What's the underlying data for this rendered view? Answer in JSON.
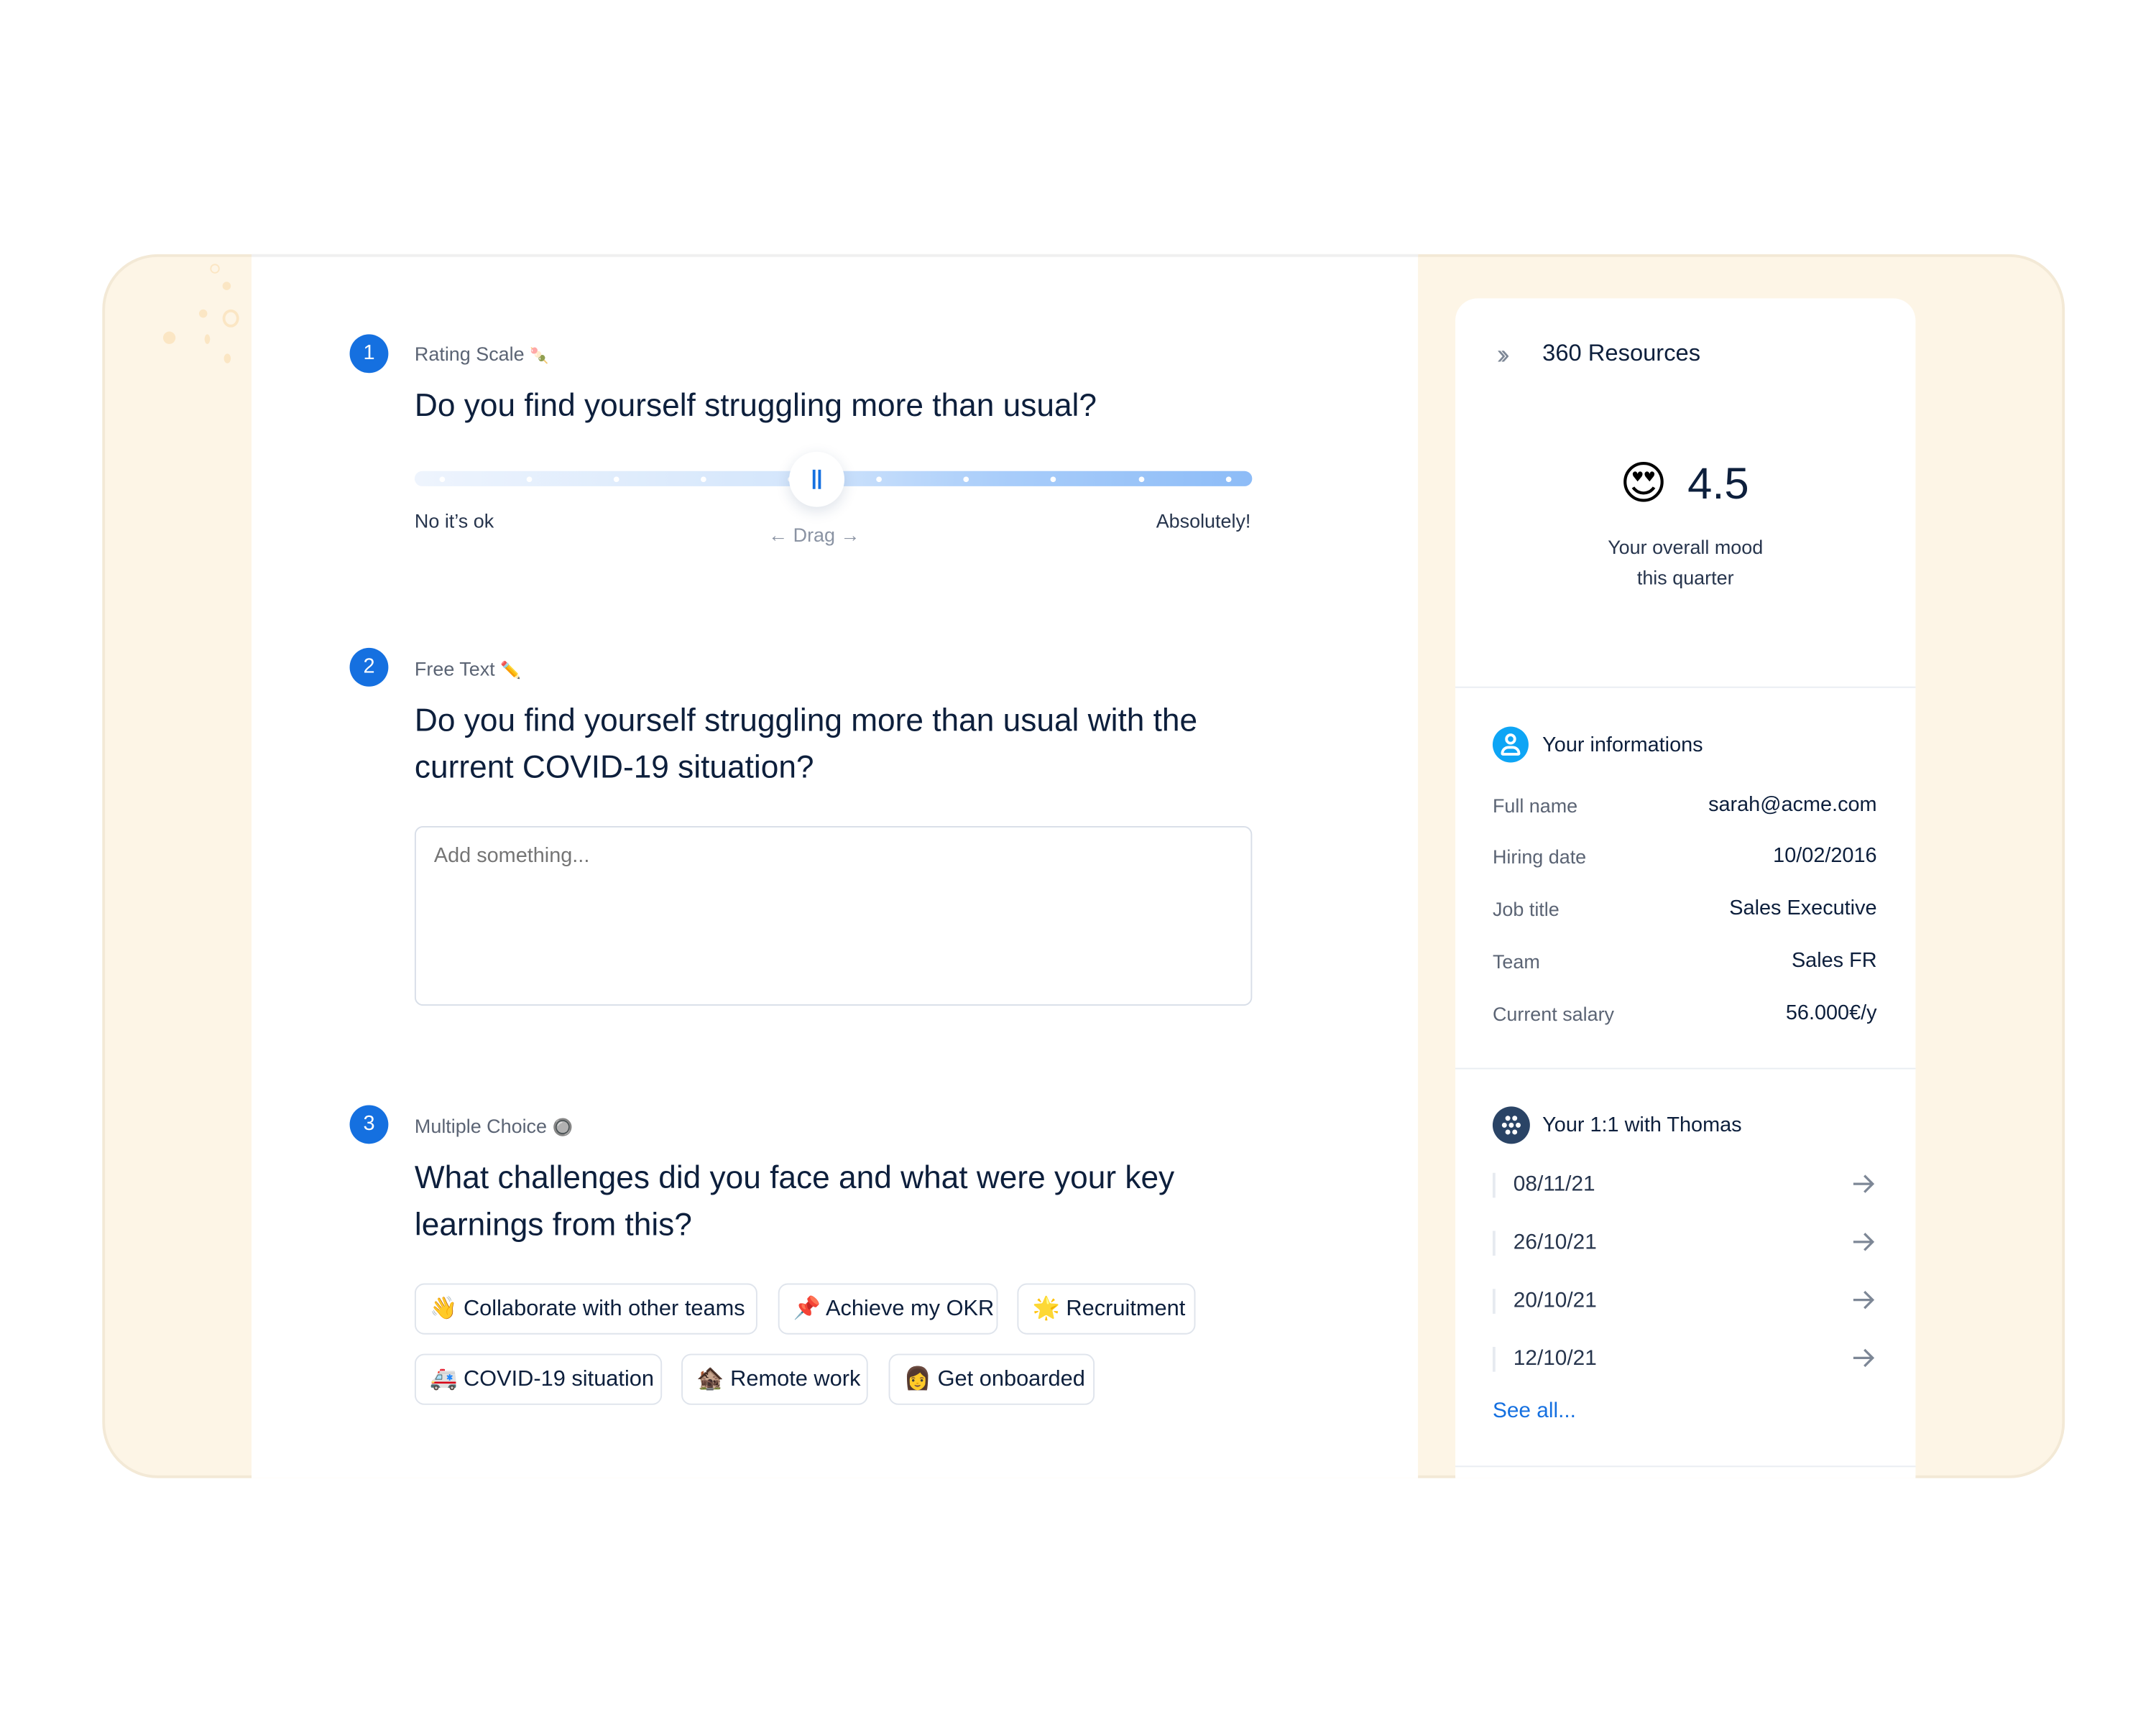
{
  "colors": {
    "accent": "#1570e0",
    "navy": "#0d1f3c",
    "frame_bg": "#fdf5e6"
  },
  "questions": [
    {
      "number": "1",
      "type_label": "Rating Scale",
      "type_emoji": "🍡",
      "title": "Do you find yourself struggling more than usual?",
      "slider": {
        "min_label": "No it’s ok",
        "max_label": "Absolutely!",
        "drag_label": "Drag",
        "value_fraction": 0.48
      }
    },
    {
      "number": "2",
      "type_label": "Free Text",
      "type_emoji": "✏️",
      "title": "Do you find yourself struggling more than usual with the current COVID-19 situation?",
      "placeholder": "Add something..."
    },
    {
      "number": "3",
      "type_label": "Multiple Choice",
      "type_emoji": "🔘",
      "title": "What challenges did you face and what were your key learnings from this?",
      "choices": [
        {
          "emoji": "👋",
          "label": "Collaborate with other teams"
        },
        {
          "emoji": "📌",
          "label": "Achieve my OKR"
        },
        {
          "emoji": "🌟",
          "label": "Recruitment"
        },
        {
          "emoji": "🚑",
          "label": "COVID-19 situation"
        },
        {
          "emoji": "🏚️",
          "label": "Remote work"
        },
        {
          "emoji": "👩",
          "label": "Get onboarded"
        }
      ]
    }
  ],
  "sidebar": {
    "title": "360 Resources",
    "mood": {
      "emoji": "😍",
      "score": "4.5",
      "caption_line1": "Your overall mood",
      "caption_line2": "this quarter"
    },
    "info": {
      "title": "Your informations",
      "rows": [
        {
          "label": "Full name",
          "value": "sarah@acme.com"
        },
        {
          "label": "Hiring date",
          "value": "10/02/2016"
        },
        {
          "label": "Job title",
          "value": "Sales Executive"
        },
        {
          "label": "Team",
          "value": "Sales FR"
        },
        {
          "label": "Current salary",
          "value": "56.000€/y"
        }
      ]
    },
    "one_on_one": {
      "title": "Your 1:1 with Thomas",
      "dates": [
        "08/11/21",
        "26/10/21",
        "20/10/21",
        "12/10/21"
      ],
      "see_all": "See all..."
    }
  }
}
